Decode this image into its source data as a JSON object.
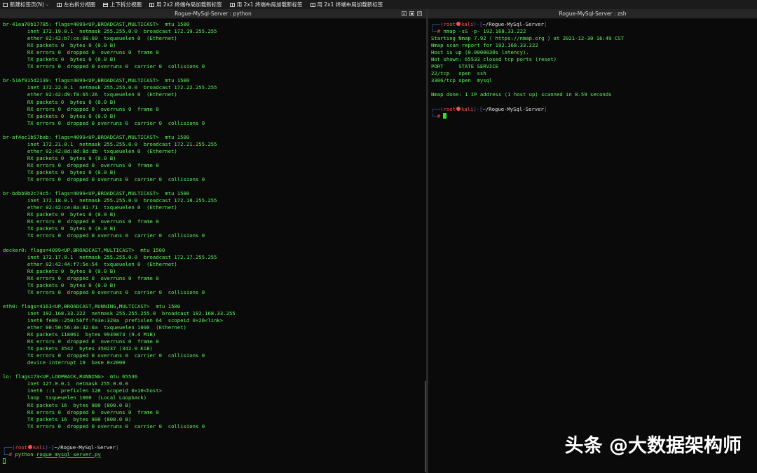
{
  "tabs": [
    {
      "label": "新建标签页(N)",
      "icon": "terminal-icon",
      "caret": "⌄"
    },
    {
      "label": "左右拆分视图",
      "icon": "split-vertical-icon"
    },
    {
      "label": "上下拆分视图",
      "icon": "split-horizontal-icon"
    },
    {
      "label": "用 2x2 终端布局加载新标签",
      "icon": "grid-layout-icon"
    },
    {
      "label": "用 2x1 终端布局加载新标签",
      "icon": "grid-layout-icon"
    },
    {
      "label": "用 2x1 终端布局加载新标签",
      "icon": "grid-layout-icon"
    }
  ],
  "left_title": "Rogue-MySql-Server : python",
  "right_title": "Rogue-MySql-Server : zsh",
  "left_lines": [
    "br-41ea70b17785: flags=4099<UP,BROADCAST,MULTICAST>  mtu 1500",
    "        inet 172.19.0.1  netmask 255.255.0.0  broadcast 172.19.255.255",
    "        ether 02:42:b7:ce:98:60  txqueuelen 0  (Ethernet)",
    "        RX packets 0  bytes 0 (0.0 B)",
    "        RX errors 0  dropped 0  overruns 0  frame 0",
    "        TX packets 0  bytes 0 (0.0 B)",
    "        TX errors 0  dropped 0 overruns 0  carrier 0  collisions 0",
    "",
    "br-516f915d2130: flags=4099<UP,BROADCAST,MULTICAST>  mtu 1500",
    "        inet 172.22.0.1  netmask 255.255.0.0  broadcast 172.22.255.255",
    "        ether 02:42:d9:f8:65:26  txqueuelen 0  (Ethernet)",
    "        RX packets 0  bytes 0 (0.0 B)",
    "        RX errors 0  dropped 0  overruns 0  frame 0",
    "        TX packets 0  bytes 0 (0.0 B)",
    "        TX errors 0  dropped 0 overruns 0  carrier 0  collisions 0",
    "",
    "br-af4ec1b57bab: flags=4099<UP,BROADCAST,MULTICAST>  mtu 1500",
    "        inet 172.21.0.1  netmask 255.255.0.0  broadcast 172.21.255.255",
    "        ether 02:42:8d:8d:8d:db  txqueuelen 0  (Ethernet)",
    "        RX packets 0  bytes 0 (0.0 B)",
    "        RX errors 0  dropped 0  overruns 0  frame 0",
    "        TX packets 0  bytes 0 (0.0 B)",
    "        TX errors 0  dropped 0 overruns 0  carrier 0  collisions 0",
    "",
    "br-bdbb9b2c74c5: flags=4099<UP,BROADCAST,MULTICAST>  mtu 1500",
    "        inet 172.18.0.1  netmask 255.255.0.0  broadcast 172.18.255.255",
    "        ether 02:42:ce:8a:81:71  txqueuelen 0  (Ethernet)",
    "        RX packets 0  bytes 0 (0.0 B)",
    "        RX errors 0  dropped 0  overruns 0  frame 0",
    "        TX packets 0  bytes 0 (0.0 B)",
    "        TX errors 0  dropped 0 overruns 0  carrier 0  collisions 0",
    "",
    "docker0: flags=4099<UP,BROADCAST,MULTICAST>  mtu 1500",
    "        inet 172.17.0.1  netmask 255.255.0.0  broadcast 172.17.255.255",
    "        ether 02:42:44:f7:5e:54  txqueuelen 0  (Ethernet)",
    "        RX packets 0  bytes 0 (0.0 B)",
    "        RX errors 0  dropped 0  overruns 0  frame 0",
    "        TX packets 0  bytes 0 (0.0 B)",
    "        TX errors 0  dropped 0 overruns 0  carrier 0  collisions 0",
    "",
    "eth0: flags=4163<UP,BROADCAST,RUNNING,MULTICAST>  mtu 1500",
    "        inet 192.168.33.222  netmask 255.255.255.0  broadcast 192.168.33.255",
    "        inet6 fe80::250:56ff:fe3e:320a  prefixlen 64  scopeid 0×20<link>",
    "        ether 00:50:56:3e:32:0a  txqueuelen 1000  (Ethernet)",
    "        RX packets 118061  bytes 9939873 (9.4 MiB)",
    "        RX errors 0  dropped 0  overruns 0  frame 0",
    "        TX packets 3542  bytes 350237 (342.0 KiB)",
    "        TX errors 0  dropped 0 overruns 0  carrier 0  collisions 0",
    "        device interrupt 19  base 0×2000",
    "",
    "lo: flags=73<UP,LOOPBACK,RUNNING>  mtu 65536",
    "        inet 127.0.0.1  netmask 255.0.0.0",
    "        inet6 ::1  prefixlen 128  scopeid 0×10<host>",
    "        loop  txqueuelen 1000  (Local Loopback)",
    "        RX packets 16  bytes 800 (800.0 B)",
    "        RX errors 0  dropped 0  overruns 0  frame 0",
    "        TX packets 16  bytes 800 (800.0 B)",
    "        TX errors 0  dropped 0 overruns 0  carrier 0  collisions 0",
    "",
    ""
  ],
  "prompt": {
    "top_open": "┌──(",
    "user": "root",
    "host": "kali",
    "mid": ")-[",
    "dir": "~/Rogue-MySql-Server",
    "close": "]",
    "bottom": "└─",
    "hash": "# "
  },
  "left_command": {
    "cmd": "python ",
    "arg": "rogue_mysql_server.py"
  },
  "right_command": "nmap -sS -p- 192.168.33.222",
  "right_lines": [
    "Starting Nmap 7.92 ( https://nmap.org ) at 2021-12-30 16:49 CST",
    "Nmap scan report for 192.168.33.222",
    "Host is up (0.0000030s latency).",
    "Not shown: 65533 closed tcp ports (reset)",
    "PORT     STATE SERVICE",
    "22/tcp   open  ssh",
    "3306/tcp open  mysql",
    "",
    "Nmap done: 1 IP address (1 host up) scanned in 8.59 seconds",
    ""
  ],
  "watermark": "头条 @大数据架构师",
  "colors": {
    "terminal_green": "#5bf55b",
    "prompt_blue": "#4a76d9",
    "root_red": "#ff4d4d",
    "background": "#0a0a0a"
  }
}
